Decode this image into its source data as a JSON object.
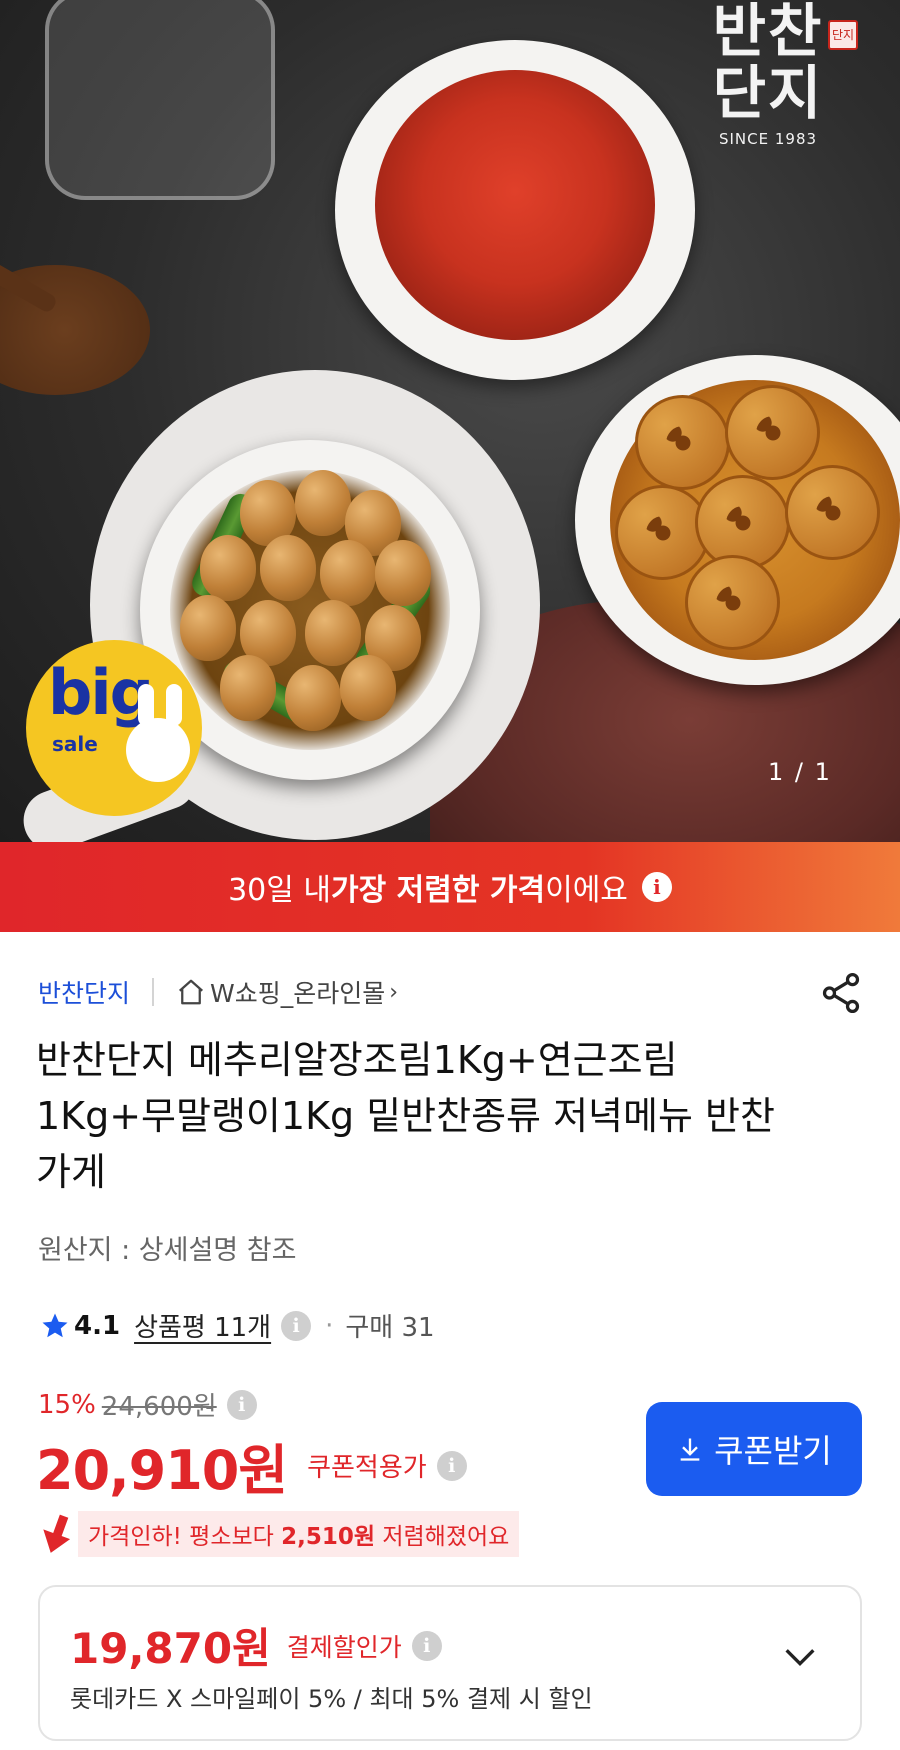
{
  "hero": {
    "brand_logo_text": "반찬단지",
    "brand_logo_since": "SINCE 1983",
    "brand_logo_seal": "단지",
    "badge_big": "big",
    "badge_sale": "sale",
    "image_counter": "1 / 1"
  },
  "banner": {
    "prefix": "30일 내 ",
    "highlight": "가장 저렴한 가격",
    "suffix": "이에요",
    "info_icon": "i"
  },
  "store": {
    "name": "반찬단지",
    "mall_link": "W쇼핑_온라인몰",
    "chevron": "›"
  },
  "product": {
    "title": "반찬단지 메추리알장조림1Kg+연근조림1Kg+무말랭이1Kg 밑반찬종류 저녁메뉴 반찬가게",
    "origin": "원산지 : 상세설명 참조"
  },
  "rating": {
    "score": "4.1",
    "reviews": "상품평 11개",
    "info_icon": "i",
    "separator": "·",
    "purchases": "구매 31"
  },
  "price": {
    "discount_pct": "15%",
    "original": "24,600원",
    "info_icon": "i",
    "sale": "20,910원",
    "coupon_label": "쿠폰적용가",
    "coupon_button": "쿠폰받기"
  },
  "price_drop": {
    "prefix": "가격인하! 평소보다 ",
    "amount": "2,510원",
    "suffix": " 저렴해졌어요"
  },
  "payment": {
    "price": "19,870원",
    "label": "결제할인가",
    "info_icon": "i",
    "description": "롯데카드 X 스마일페이 5% / 최대 5% 결제 시 할인"
  },
  "colors": {
    "accent_red": "#e0262a",
    "brand_blue": "#1b5cf0",
    "store_blue": "#1c4fd8"
  },
  "icons": [
    "home-icon",
    "share-icon",
    "star-icon",
    "info-icon",
    "download-icon",
    "price-drop-arrow-icon",
    "chevron-down-icon"
  ]
}
